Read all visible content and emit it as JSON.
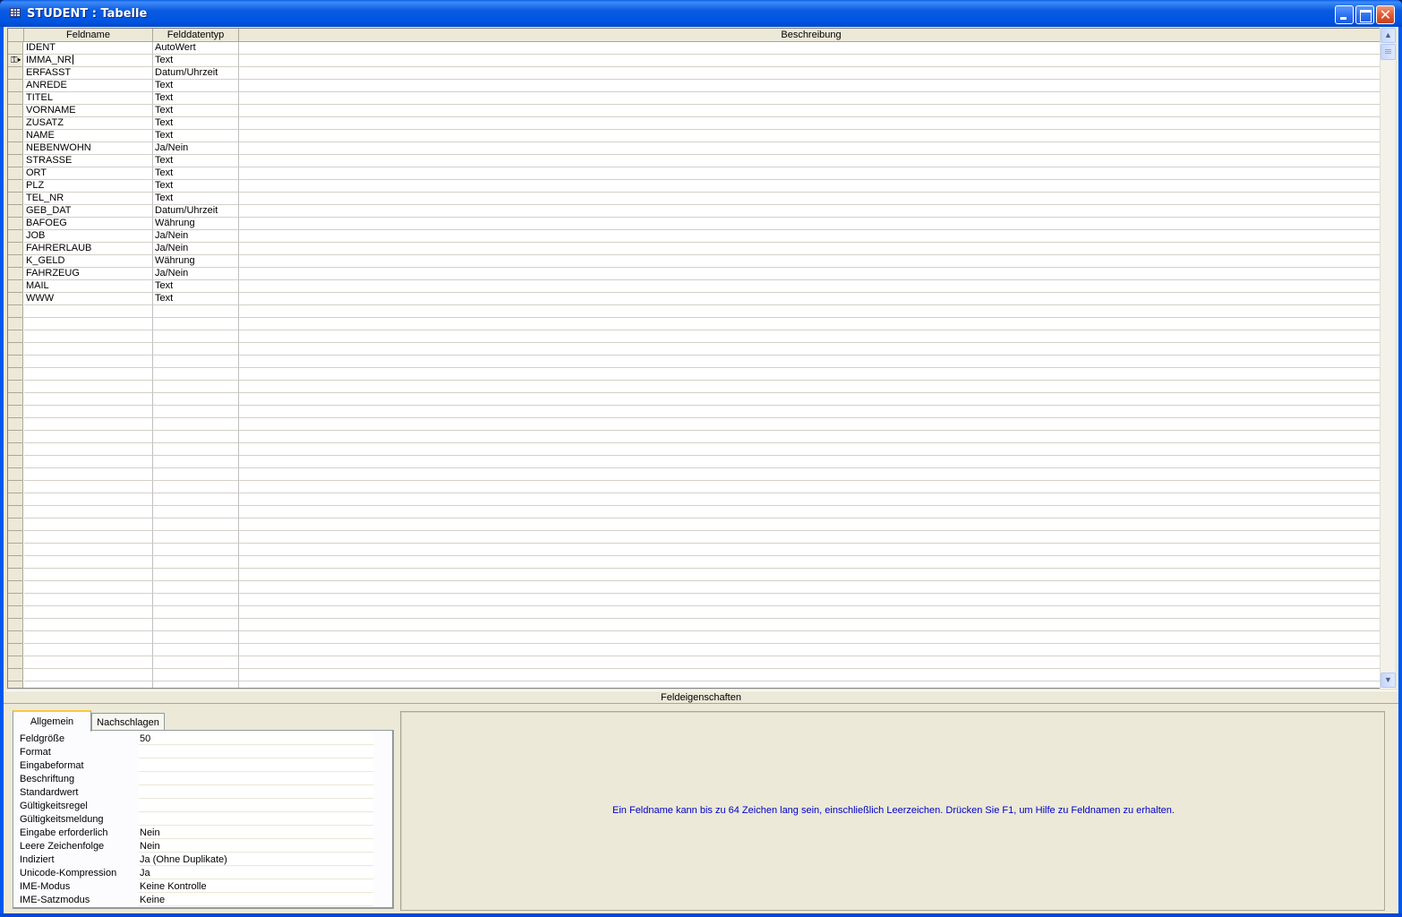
{
  "window": {
    "title": "STUDENT : Tabelle",
    "close_glyph": "✕"
  },
  "grid": {
    "columns": [
      "Feldname",
      "Felddatentyp",
      "Beschreibung"
    ],
    "rows": [
      {
        "name": "IDENT",
        "type": "AutoWert"
      },
      {
        "name": "IMMA_NR",
        "type": "Text",
        "primary_key": true,
        "current": true
      },
      {
        "name": "ERFASST",
        "type": "Datum/Uhrzeit"
      },
      {
        "name": "ANREDE",
        "type": "Text"
      },
      {
        "name": "TITEL",
        "type": "Text"
      },
      {
        "name": "VORNAME",
        "type": "Text"
      },
      {
        "name": "ZUSATZ",
        "type": "Text"
      },
      {
        "name": "NAME",
        "type": "Text"
      },
      {
        "name": "NEBENWOHN",
        "type": "Ja/Nein"
      },
      {
        "name": "STRASSE",
        "type": "Text"
      },
      {
        "name": "ORT",
        "type": "Text"
      },
      {
        "name": "PLZ",
        "type": "Text"
      },
      {
        "name": "TEL_NR",
        "type": "Text"
      },
      {
        "name": "GEB_DAT",
        "type": "Datum/Uhrzeit"
      },
      {
        "name": "BAFOEG",
        "type": "Währung"
      },
      {
        "name": "JOB",
        "type": "Ja/Nein"
      },
      {
        "name": "FAHRERLAUB",
        "type": "Ja/Nein"
      },
      {
        "name": "K_GELD",
        "type": "Währung"
      },
      {
        "name": "FAHRZEUG",
        "type": "Ja/Nein"
      },
      {
        "name": "MAIL",
        "type": "Text"
      },
      {
        "name": "WWW",
        "type": "Text"
      }
    ],
    "key_glyph": "⚿▸"
  },
  "scrollbar": {
    "up_glyph": "▲",
    "down_glyph": "▼"
  },
  "field_properties": {
    "title": "Feldeigenschaften",
    "tabs": [
      "Allgemein",
      "Nachschlagen"
    ],
    "properties": [
      {
        "label": "Feldgröße",
        "value": "50"
      },
      {
        "label": "Format",
        "value": ""
      },
      {
        "label": "Eingabeformat",
        "value": ""
      },
      {
        "label": "Beschriftung",
        "value": ""
      },
      {
        "label": "Standardwert",
        "value": ""
      },
      {
        "label": "Gültigkeitsregel",
        "value": ""
      },
      {
        "label": "Gültigkeitsmeldung",
        "value": ""
      },
      {
        "label": "Eingabe erforderlich",
        "value": "Nein"
      },
      {
        "label": "Leere Zeichenfolge",
        "value": "Nein"
      },
      {
        "label": "Indiziert",
        "value": "Ja (Ohne Duplikate)"
      },
      {
        "label": "Unicode-Kompression",
        "value": "Ja"
      },
      {
        "label": "IME-Modus",
        "value": "Keine Kontrolle"
      },
      {
        "label": "IME-Satzmodus",
        "value": "Keine"
      }
    ],
    "help_text": "Ein Feldname kann bis zu 64 Zeichen lang sein, einschließlich Leerzeichen. Drücken Sie F1, um Hilfe zu Feldnamen zu erhalten."
  }
}
